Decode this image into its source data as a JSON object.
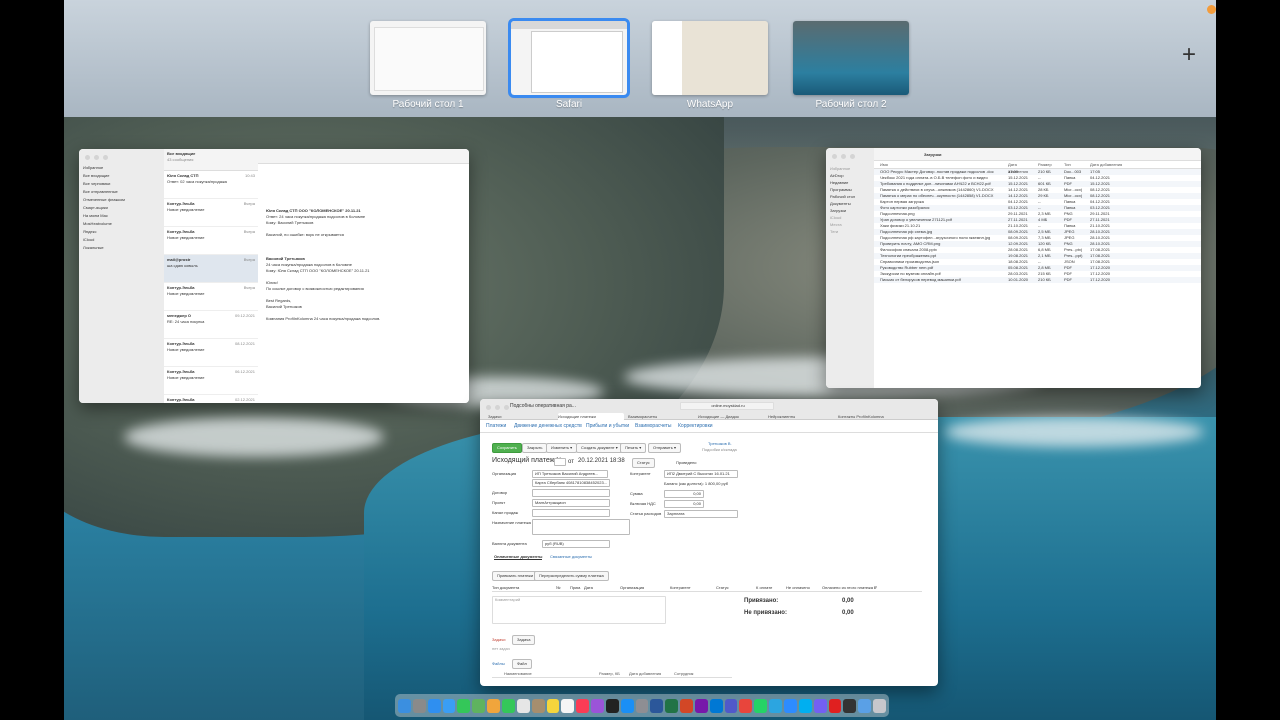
{
  "spaces": [
    {
      "label": "Рабочий стол 1",
      "active": false
    },
    {
      "label": "Safari",
      "active": true
    },
    {
      "label": "WhatsApp",
      "active": false
    },
    {
      "label": "Рабочий стол 2",
      "active": false
    }
  ],
  "add_space": "+",
  "mail": {
    "mailbox_title": "Все входящие",
    "mailbox_count": "43 сообщения",
    "sidebar": [
      "Избранное",
      "Все входящие",
      "Все черновики",
      "Все отправленные",
      "Отмеченные флажком",
      "Смарт-ящики",
      "На моем Mac",
      "MosHeatvolume",
      "Яндекс",
      "iCloud",
      "Локальные"
    ],
    "messages": [
      {
        "from": "Юля Склад СТП",
        "subject": "Ответ: 02 часа покупка/продажа",
        "time": "10:43"
      },
      {
        "from": "Контур.Эльба",
        "subject": "Новое уведомление",
        "time": "Вчера"
      },
      {
        "from": "Контур.Эльба",
        "subject": "Новое уведомление",
        "time": "Вчера"
      },
      {
        "from": "mail@prostr",
        "subject": "ша сдаю ковыль",
        "time": "Вчера"
      },
      {
        "from": "Контур.Эльба",
        "subject": "Новое уведомление",
        "time": "Вчера"
      },
      {
        "from": "менеджер О",
        "subject": "RE: 24 часа покупка",
        "time": "09.12.2021"
      },
      {
        "from": "Контур.Эльба",
        "subject": "Новое уведомление",
        "time": "08.12.2021"
      },
      {
        "from": "Контур.Эльба",
        "subject": "Новое уведомление",
        "time": "06.12.2021"
      },
      {
        "from": "Контур.Эльба",
        "subject": "Новое уведомление",
        "time": "02.12.2021"
      },
      {
        "from": "Служба под",
        "subject": "Ответ: Vaii (служба)",
        "time": "27.11.2021"
      },
      {
        "from": "Контур.Эльба",
        "subject": "Новое уведомление",
        "time": "19.11.2021"
      }
    ],
    "reading": {
      "line1": "Юля Склад СТП ООО \"КОЛОМЕНСКОЕ\" 20.11.21",
      "line2": "Ответ: 24 часа покупка/продажа подсолов в Коломне",
      "line3": "Кому: Василий Третьяков",
      "line4": "Василий, по ошибке: ворк не открывается",
      "line5": "Василий Третьяков",
      "line6": "24 часа покупка/продажа подсолов в Коломне",
      "line7": "Кому: Юля Склад СТП ООО \"КОЛОМЕНСКОЕ\" 20.11.21",
      "line8": "Юлия!",
      "line9": "По ссылке договор с возможностью редактирования",
      "line10": "Best Regards,",
      "line11": "Василий Третьяков",
      "line12": "Компания ProfiInKolomna 24 часа покупка/продажа подсолов."
    }
  },
  "finder": {
    "title": "Загрузки",
    "columns": [
      "Имя",
      "Дата изменения",
      "Размер",
      "Тип",
      "Дата добавления"
    ],
    "sidebar": [
      "Избранное",
      "AirDrop",
      "Недавние",
      "Программы",
      "Рабочий стол",
      "Документы",
      "Загрузки",
      "iCloud",
      "Места",
      "Теги"
    ],
    "files": [
      {
        "name": "ООО Ресурс Мастер Договор..постав продажи подсолов .doc",
        "date": "17:00",
        "size": "210 КБ",
        "kind": "Doc...003",
        "added": "17:05"
      },
      {
        "name": "Чекбокс 2021 года оплата..в О.Б.В телефон фото и видео",
        "date": "15.12.2021",
        "size": "--",
        "kind": "Папка",
        "added": "04.12.2021"
      },
      {
        "name": "Требования к подделке доп...личинами АНЧ22 и ВСН22.pdf",
        "date": "15.12.2021",
        "size": "601 КБ",
        "kind": "PDF",
        "added": "15.12.2021"
      },
      {
        "name": "Памятка о действиях в случа...олжников (1442860) V1.DOCX",
        "date": "14.12.2021",
        "size": "28 КБ",
        "kind": "Micr...ocx)",
        "added": "08.12.2021"
      },
      {
        "name": "Памятка о мерах по обеспеч...окупности (1442858) V1.DOCX",
        "date": "14.12.2021",
        "size": "29 КБ",
        "kind": "Micr...ocx)",
        "added": "08.12.2021"
      },
      {
        "name": "Картон первая загрузка",
        "date": "04.12.2021",
        "size": "--",
        "kind": "Папка",
        "added": "04.12.2021"
      },
      {
        "name": "Фото картонки разобрался",
        "date": "03.12.2021",
        "size": "--",
        "kind": "Папка",
        "added": "03.12.2021"
      },
      {
        "name": "Подсолнечная.png",
        "date": "29.11.2021",
        "size": "2,3 МБ",
        "kind": "PNG",
        "added": "29.11.2021"
      },
      {
        "name": "Уран договор о увеличении 271121.pdf",
        "date": "27.11.2021",
        "size": "4 МБ",
        "kind": "PDF",
        "added": "27.11.2021"
      },
      {
        "name": "Хаки физики 21.10.21",
        "date": "21.10.2021",
        "size": "--",
        "kind": "Папка",
        "added": "21.10.2021"
      },
      {
        "name": "Подсолнечная рф схема.jpg",
        "date": "08.09.2021",
        "size": "2,5 МБ",
        "kind": "JPEG",
        "added": "28.10.2021"
      },
      {
        "name": "Подсолнечная рф картофел...ягрузочного поля экземпл.jpg",
        "date": "08.09.2021",
        "size": "7,3 МБ",
        "kind": "JPEG",
        "added": "28.10.2021"
      },
      {
        "name": "Проверить почту, АМО CRM.png",
        "date": "12.09.2021",
        "size": "120 КБ",
        "kind": "PNG",
        "added": "28.10.2021"
      },
      {
        "name": "Философия сначала 2008.pptx",
        "date": "28.08.2021",
        "size": "6,8 МБ",
        "kind": "Pres...ptx)",
        "added": "17.08.2021"
      },
      {
        "name": "Технологии преображения.ppt",
        "date": "19.08.2021",
        "size": "2,1 МБ",
        "kind": "Pres...ppt)",
        "added": "17.08.2021"
      },
      {
        "name": "Справочники производства.json",
        "date": "18.08.2021",
        "size": "--",
        "kind": "JSON",
        "added": "17.08.2021"
      },
      {
        "name": "Руководство Rubber nem.pdf",
        "date": "05.08.2021",
        "size": "2,8 МБ",
        "kind": "PDF",
        "added": "17.12.2020"
      },
      {
        "name": "Экскурсии по музеям онлайн.pdf",
        "date": "28.03.2021",
        "size": "215 КБ",
        "kind": "PDF",
        "added": "17.12.2020"
      },
      {
        "name": "Письмо от белорусов перевод машинки.pdf",
        "date": "10.01.2020",
        "size": "210 КБ",
        "kind": "PDF",
        "added": "17.12.2020"
      }
    ]
  },
  "safari": {
    "tab_title": "Подсобны оперативная ра...",
    "url": "online.moysklad.ru",
    "tabs": [
      "Задачи",
      "Исходящие платежи",
      "Взаиморасчеты",
      "Исходящие — Диадок",
      "Нейроклиенты",
      "Контакты ProfiInKolomna"
    ],
    "nav": [
      "Платежи",
      "Движение денежных средств",
      "Прибыли и убытки",
      "Взаиморасчеты",
      "Корректировки"
    ],
    "toolbar": {
      "save": "Сохранить",
      "close": "Закрыть",
      "change": "Изменить ▾",
      "create_doc": "Создать документ ▾",
      "print": "Печать ▾",
      "send": "Отправить ▾",
      "author": "Третьяков В.",
      "author_sub": "Подсобки к/склада"
    },
    "form": {
      "title": "Исходящий платеж №",
      "date_from": "от",
      "date": "20.12.2021 18:38",
      "status": "Статус",
      "held": "Проведено",
      "org_label": "Организация",
      "org_value": "ИП Третьяков Василий Андреев...",
      "account_value": "Карта Сбербанк 40817810838452023...",
      "counterparty_label": "Контрагент",
      "counterparty_value": "ИП2 Дмитрий С Высотах 16.01.21",
      "balance": "Баланс (как долгота): 1 800,00 руб",
      "contract_label": "Договор",
      "project_label": "Проект",
      "project_value": "МагнАттракцион",
      "sum_label": "Сумма",
      "sum_value": "0,00",
      "vat_label": "Включая НДС",
      "vat_value": "0,00",
      "sales_label": "Канал продаж",
      "expense_label": "Статья расходов",
      "expense_value": "Зарплата",
      "purpose_label": "Назначение платежа",
      "currency_label": "Валюта документа",
      "currency_value": "руб (RUB)",
      "subtab1": "Оплаченные документы",
      "subtab2": "Связанные документы",
      "apply_btn": "Привязать платежи",
      "redistribute_btn": "Перераспределить сумму платежа",
      "columns": [
        "Тип документа",
        "№",
        "Прим.",
        "Дата",
        "Организация",
        "Контрагент",
        "Статус",
        "К оплате",
        "Не оплачено",
        "Оплачено из этого платежа ₽"
      ],
      "comment": "Комментарий",
      "bound_label": "Привязано:",
      "bound_value": "0,00",
      "unbound_label": "Не привязано:",
      "unbound_value": "0,00",
      "tasks_label": "Задачи",
      "tasks_btn": "Задача",
      "tasks_empty": "нет задач",
      "files_label": "Файлы",
      "files_btn": "Файл",
      "files_cols": [
        "Наименование",
        "Размер, КБ",
        "Дата добавления",
        "Сотрудник"
      ]
    }
  },
  "dock": {
    "icons": [
      "finder-icon",
      "launchpad-icon",
      "safari-icon",
      "mail-icon",
      "messages-icon",
      "maps-icon",
      "photos-icon",
      "facetime-icon",
      "calendar-icon",
      "contacts-icon",
      "notes-icon",
      "reminders-icon",
      "music-icon",
      "podcasts-icon",
      "tv-icon",
      "appstore-icon",
      "settings-icon",
      "word-icon",
      "excel-icon",
      "powerpoint-icon",
      "onenote-icon",
      "outlook-icon",
      "teams-icon",
      "chrome-icon",
      "whatsapp-icon",
      "telegram-icon",
      "zoom-icon",
      "skype-icon",
      "viber-icon",
      "acrobat-icon",
      "terminal-icon",
      "downloads-icon",
      "trash-icon"
    ],
    "colors": [
      "#3b8fe0",
      "#8a8a8a",
      "#2f8ff0",
      "#3a9ef5",
      "#34c759",
      "#5fb35f",
      "#f0a53c",
      "#34c759",
      "#e6e6e6",
      "#a68e6e",
      "#f5d53c",
      "#f5f5f5",
      "#fa3c55",
      "#9b54d8",
      "#222222",
      "#1a8ff5",
      "#8e8e93",
      "#2b579a",
      "#217346",
      "#d24726",
      "#7719aa",
      "#0078d4",
      "#5059c9",
      "#e8453c",
      "#25d366",
      "#2ca5e0",
      "#2d8cff",
      "#00aff0",
      "#7360f2",
      "#e02020",
      "#333333",
      "#5aa0e6",
      "#c7c7cc"
    ]
  }
}
